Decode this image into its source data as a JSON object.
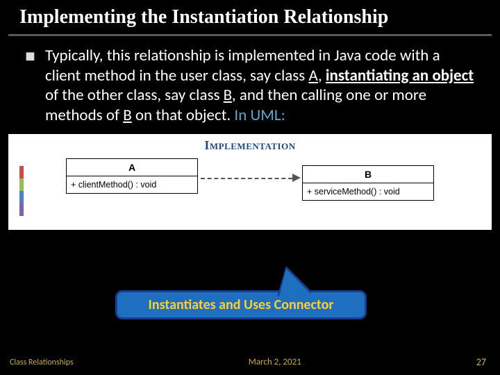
{
  "title": "Implementing the Instantiation Relationship",
  "bullet": {
    "text_parts": {
      "p1": "Typically, this relationship is implemented in Java code with a client method in the user class, say class ",
      "a": "A",
      "p2": ", ",
      "inst": "instantiating an object",
      "p3": " of the other class, say class ",
      "b": "B",
      "p4": ", and then calling one or more methods of ",
      "b2": "B",
      "p5": " on that object.  ",
      "uml": "In UML:"
    }
  },
  "diagram": {
    "heading": "Implementation",
    "classA": {
      "name": "A",
      "method": "+ clientMethod() : void"
    },
    "classB": {
      "name": "B",
      "method": "+ serviceMethod() : void"
    }
  },
  "callout": "Instantiates and Uses Connector",
  "footer": {
    "left": "Class Relationships",
    "date": "March 2, 2021",
    "page": "27"
  }
}
